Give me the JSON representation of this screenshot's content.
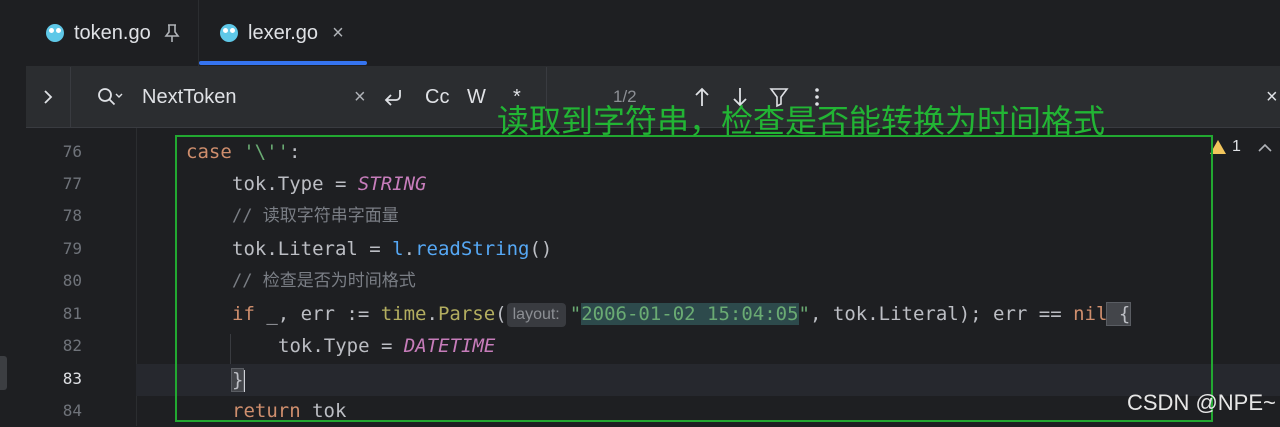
{
  "tabs": [
    {
      "label": "token.go",
      "icon": "gopher-icon",
      "pinned": true
    },
    {
      "label": "lexer.go",
      "icon": "gopher-icon",
      "active": true
    }
  ],
  "search": {
    "query": "NextToken",
    "match_case_label": "Cc",
    "whole_words_label": "W",
    "regex_label": "*",
    "result_count": "1/2"
  },
  "annotation": {
    "text": "读取到字符串，检查是否能转换为时间格式",
    "color": "#22a831"
  },
  "gutter": {
    "lines": [
      "76",
      "77",
      "78",
      "79",
      "80",
      "81",
      "82",
      "83",
      "84"
    ],
    "current": "83"
  },
  "inspection": {
    "count": "1"
  },
  "code": {
    "l76": {
      "kw": "case",
      "str": "'\\''",
      "rest": ":"
    },
    "l77": {
      "pre": "tok.Type = ",
      "const": "STRING"
    },
    "l78": {
      "comment": "// 读取字符串字面量"
    },
    "l79": {
      "pre": "tok.Literal = ",
      "recv": "l",
      "dot": ".",
      "fn": "readString",
      "post": "()"
    },
    "l80": {
      "comment": "// 检查是否为时间格式"
    },
    "l81": {
      "kw_if": "if",
      "mid": " _, err := ",
      "pkg": "time",
      "dot": ".",
      "fn": "Parse",
      "paren": "(",
      "hint": "layout:",
      "q1": "\"",
      "lit": "2006-01-02 15:04:05",
      "q2": "\"",
      "after": ", tok.Literal); err == ",
      "kw_nil": "nil",
      "brace": " {"
    },
    "l82": {
      "pre": "tok.Type = ",
      "const": "DATETIME"
    },
    "l83": {
      "brace": "}"
    },
    "l84": {
      "kw": "return",
      "rest": " tok"
    }
  },
  "watermark": "CSDN @NPE~"
}
